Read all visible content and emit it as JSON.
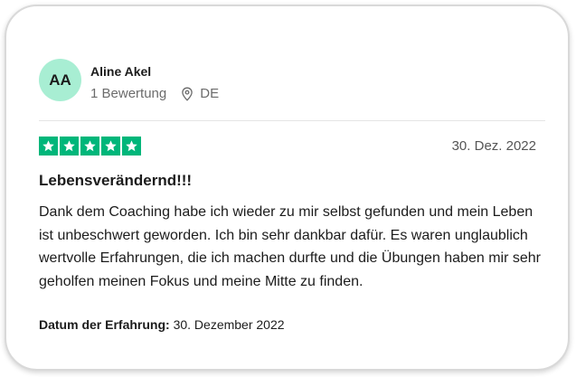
{
  "reviewer": {
    "initials": "AA",
    "name": "Aline Akel",
    "review_count": "1 Bewertung",
    "country_icon": "location-pin-icon",
    "country": "DE",
    "avatar_color": "#a8eed3"
  },
  "review": {
    "rating": 5,
    "max_rating": 5,
    "star_color": "#00b67a",
    "star_icon": "star-icon",
    "date": "30. Dez. 2022",
    "title": "Lebensverändernd!!!",
    "body": "Dank dem Coaching habe ich wieder zu mir selbst gefunden und mein Leben ist unbeschwert geworden. Ich bin sehr dankbar dafür. Es waren unglaublich wertvolle Erfahrungen, die ich machen durfte und die Übungen haben mir sehr geholfen meinen Fokus und meine Mitte zu finden.",
    "experience_label": "Datum der Erfahrung:",
    "experience_date": "30. Dezember 2022"
  }
}
